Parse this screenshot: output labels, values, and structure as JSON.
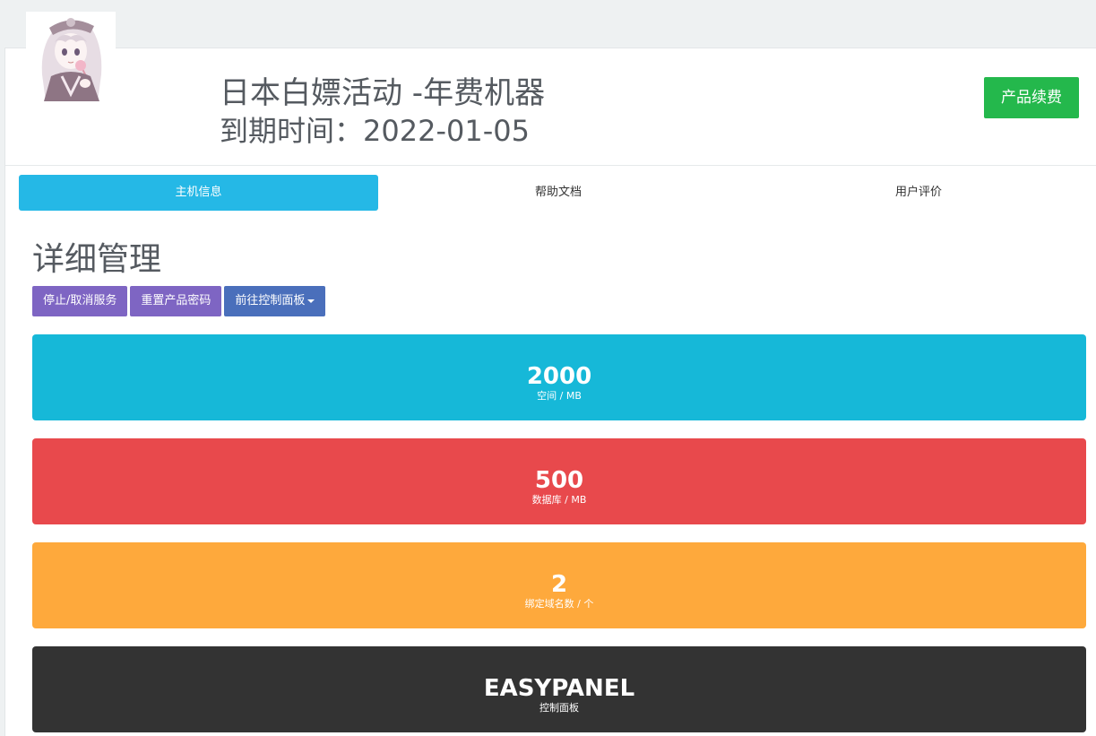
{
  "header": {
    "avatar": "anime-girl-avatar",
    "title": "日本白嫖活动 -年费机器",
    "expire_label": "到期时间：",
    "expire_date": "2022-01-05",
    "renew_label": "产品续费"
  },
  "tabs": [
    {
      "label": "主机信息",
      "active": true
    },
    {
      "label": "帮助文档",
      "active": false
    },
    {
      "label": "用户评价",
      "active": false
    }
  ],
  "section": {
    "title": "详细管理"
  },
  "actions": {
    "stop_label": "停止/取消服务",
    "reset_label": "重置产品密码",
    "panel_label": "前往控制面板",
    "panel_icon": "caret-down-icon"
  },
  "stats": [
    {
      "value": "2000",
      "label": "空间 / MB",
      "color": "#16b8d8"
    },
    {
      "value": "500",
      "label": "数据库 / MB",
      "color": "#e8494c"
    },
    {
      "value": "2",
      "label": "绑定域名数 / 个",
      "color": "#fea93c"
    },
    {
      "value": "EASYPANEL",
      "label": "控制面板",
      "color": "#333333"
    }
  ],
  "colors": {
    "renew": "#24b84c",
    "tab_active": "#25b8e6",
    "action_purple": "#7e65c3",
    "action_blue": "#4a6fbb"
  }
}
